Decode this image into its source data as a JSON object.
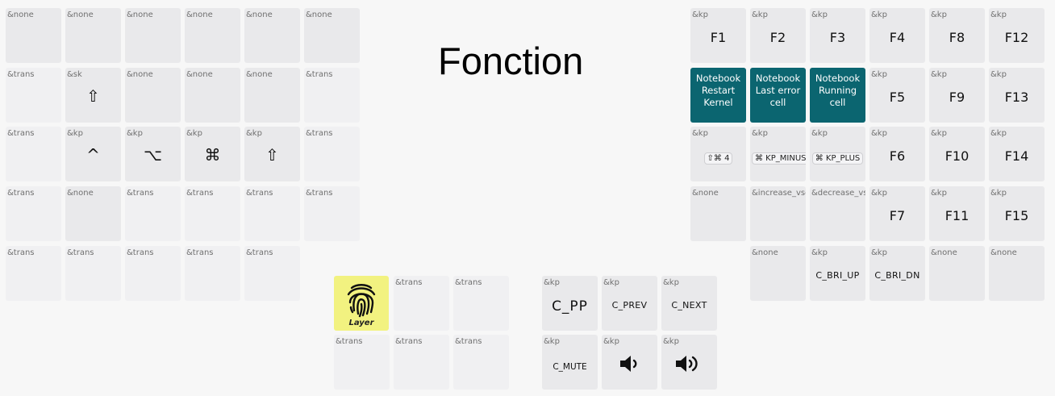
{
  "title": "Fonction",
  "left_hand": {
    "row1": [
      "&none",
      "&none",
      "&none",
      "&none",
      "&none",
      "&none"
    ],
    "row2": [
      {
        "code": "&trans",
        "label": ""
      },
      {
        "code": "&sk",
        "label": "⇧"
      },
      {
        "code": "&none",
        "label": ""
      },
      {
        "code": "&none",
        "label": ""
      },
      {
        "code": "&none",
        "label": ""
      },
      {
        "code": "&trans",
        "label": ""
      }
    ],
    "row3": [
      {
        "code": "&trans",
        "label": ""
      },
      {
        "code": "&kp",
        "label": "^"
      },
      {
        "code": "&kp",
        "label": "⌥"
      },
      {
        "code": "&kp",
        "label": "⌘"
      },
      {
        "code": "&kp",
        "label": "⇧"
      },
      {
        "code": "&trans",
        "label": ""
      }
    ],
    "row4": [
      "&trans",
      "&none",
      "&trans",
      "&trans",
      "&trans",
      "&trans"
    ],
    "row5": [
      "&trans",
      "&trans",
      "&trans",
      "&trans",
      "&trans"
    ]
  },
  "right_hand": {
    "row1": [
      {
        "code": "&kp",
        "label": "F1"
      },
      {
        "code": "&kp",
        "label": "F2"
      },
      {
        "code": "&kp",
        "label": "F3"
      },
      {
        "code": "&kp",
        "label": "F4"
      },
      {
        "code": "&kp",
        "label": "F8"
      },
      {
        "code": "&kp",
        "label": "F12"
      }
    ],
    "row2": [
      {
        "code": "",
        "label": "Notebook Restart Kernel"
      },
      {
        "code": "",
        "label": "Notebook Last error cell"
      },
      {
        "code": "",
        "label": "Notebook Running cell"
      },
      {
        "code": "&kp",
        "label": "F5"
      },
      {
        "code": "&kp",
        "label": "F9"
      },
      {
        "code": "&kp",
        "label": "F13"
      }
    ],
    "row3": [
      {
        "code": "&kp",
        "label": "⇧⌘ 4"
      },
      {
        "code": "&kp",
        "label": "⌘ KP_MINUS"
      },
      {
        "code": "&kp",
        "label": "⌘ KP_PLUS"
      },
      {
        "code": "&kp",
        "label": "F6"
      },
      {
        "code": "&kp",
        "label": "F10"
      },
      {
        "code": "&kp",
        "label": "F14"
      }
    ],
    "row4": [
      {
        "code": "&none",
        "label": ""
      },
      {
        "code": "&increase_vsc",
        "label": ""
      },
      {
        "code": "&decrease_vsc",
        "label": ""
      },
      {
        "code": "&kp",
        "label": "F7"
      },
      {
        "code": "&kp",
        "label": "F11"
      },
      {
        "code": "&kp",
        "label": "F15"
      }
    ],
    "row5": [
      {
        "code": "&none",
        "label": ""
      },
      {
        "code": "&kp",
        "label": "C_BRI_UP"
      },
      {
        "code": "&kp",
        "label": "C_BRI_DN"
      },
      {
        "code": "&none",
        "label": ""
      },
      {
        "code": "&none",
        "label": ""
      }
    ]
  },
  "left_thumb": {
    "top": [
      {
        "code": "",
        "label": "Layer"
      },
      {
        "code": "&trans",
        "label": ""
      },
      {
        "code": "&trans",
        "label": ""
      }
    ],
    "bottom": [
      {
        "code": "&trans",
        "label": ""
      },
      {
        "code": "&trans",
        "label": ""
      },
      {
        "code": "&trans",
        "label": ""
      }
    ]
  },
  "right_thumb": {
    "top": [
      {
        "code": "&kp",
        "label": "C_PP"
      },
      {
        "code": "&kp",
        "label": "C_PREV"
      },
      {
        "code": "&kp",
        "label": "C_NEXT"
      }
    ],
    "bottom": [
      {
        "code": "&kp",
        "label": "C_MUTE"
      },
      {
        "code": "&kp",
        "label": "volume-down-icon"
      },
      {
        "code": "&kp",
        "label": "volume-up-icon"
      }
    ]
  },
  "colors": {
    "teal": "#0b6570",
    "layer": "#f2f280",
    "key": "#e9e9eb"
  }
}
